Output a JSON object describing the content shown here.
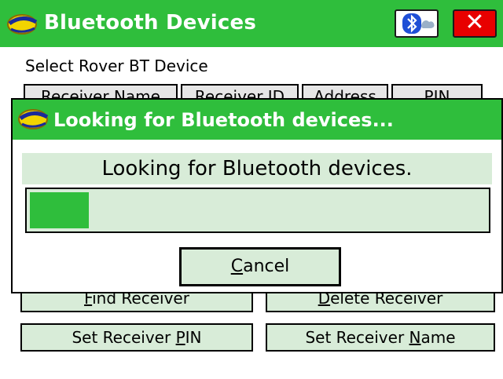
{
  "app": {
    "title": "Bluetooth Devices",
    "close_label": "✕"
  },
  "main": {
    "prompt": "Select Rover BT Device",
    "columns": [
      "Receiver Name",
      "Receiver ID",
      "Address",
      "PIN"
    ],
    "buttons": {
      "find": {
        "prefix": "",
        "mnemonic": "F",
        "rest": "ind Receiver"
      },
      "delete": {
        "prefix": "",
        "mnemonic": "D",
        "rest": "elete Receiver"
      },
      "set_pin": {
        "prefix": "Set Receiver ",
        "mnemonic": "P",
        "rest": "IN"
      },
      "set_name": {
        "prefix": "Set Receiver ",
        "mnemonic": "N",
        "rest": "ame"
      }
    }
  },
  "dialog": {
    "title": "Looking for Bluetooth devices...",
    "message": "Looking for Bluetooth devices.",
    "progress_fraction": 0.13,
    "cancel": {
      "mnemonic": "C",
      "rest": "ancel"
    }
  },
  "colors": {
    "titlebar": "#2fbe3c",
    "panel": "#d8ecd8",
    "close": "#e80000"
  },
  "icons": [
    "app-logo-icon",
    "bluetooth-icon",
    "close-icon"
  ]
}
